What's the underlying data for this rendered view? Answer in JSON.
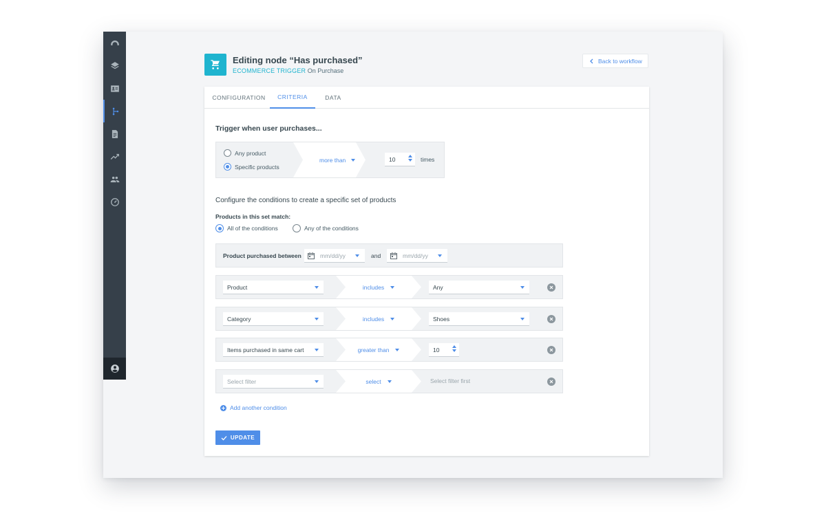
{
  "sidebar": {
    "items": [
      {
        "icon": "dashboard-gauge-icon"
      },
      {
        "icon": "layers-icon"
      },
      {
        "icon": "contact-card-icon"
      },
      {
        "icon": "workflow-branch-icon",
        "active": true
      },
      {
        "icon": "document-icon"
      },
      {
        "icon": "trending-up-icon"
      },
      {
        "icon": "people-icon"
      },
      {
        "icon": "speedometer-icon"
      }
    ],
    "user_icon": "account-circle-icon"
  },
  "header": {
    "icon": "shopping-cart-icon",
    "title": "Editing node “Has purchased”",
    "trigger_type": "ECOMMERCE TRIGGER",
    "trigger_event": "On Purchase",
    "back_label": "Back to workflow"
  },
  "tabs": [
    {
      "label": "CONFIGURATION",
      "active": false
    },
    {
      "label": "CRITERIA",
      "active": true
    },
    {
      "label": "DATA",
      "active": false
    }
  ],
  "criteria": {
    "section_title": "Trigger when user purchases...",
    "product_options": [
      {
        "label": "Any product",
        "selected": false
      },
      {
        "label": "Specific products",
        "selected": true
      }
    ],
    "comparison": "more than",
    "count": "10",
    "count_unit": "times",
    "configure_text": "Configure the conditions to create a specific set of products",
    "match_label": "Products in this set match:",
    "match_options": [
      {
        "label": "All of the conditions",
        "selected": true
      },
      {
        "label": "Any of the conditions",
        "selected": false
      }
    ],
    "date_row": {
      "label": "Product purchased between",
      "from_placeholder": "mm/dd/yy",
      "and": "and",
      "to_placeholder": "mm/dd/yy"
    },
    "conditions": [
      {
        "field": "Product",
        "operator": "includes",
        "value": "Any",
        "value_kind": "select"
      },
      {
        "field": "Category",
        "operator": "includes",
        "value": "Shoes",
        "value_kind": "select"
      },
      {
        "field": "Items purchased in same cart",
        "operator": "greater than",
        "value": "10",
        "value_kind": "number"
      },
      {
        "field": "Select filter",
        "operator": "select",
        "value": "Select filter first",
        "value_kind": "static",
        "placeholder": true
      }
    ],
    "add_condition_label": "Add another condition",
    "update_label": "UPDATE"
  },
  "colors": {
    "accent": "#4f8ee8",
    "teal": "#1fb4cf",
    "sidebar": "#36404a"
  }
}
